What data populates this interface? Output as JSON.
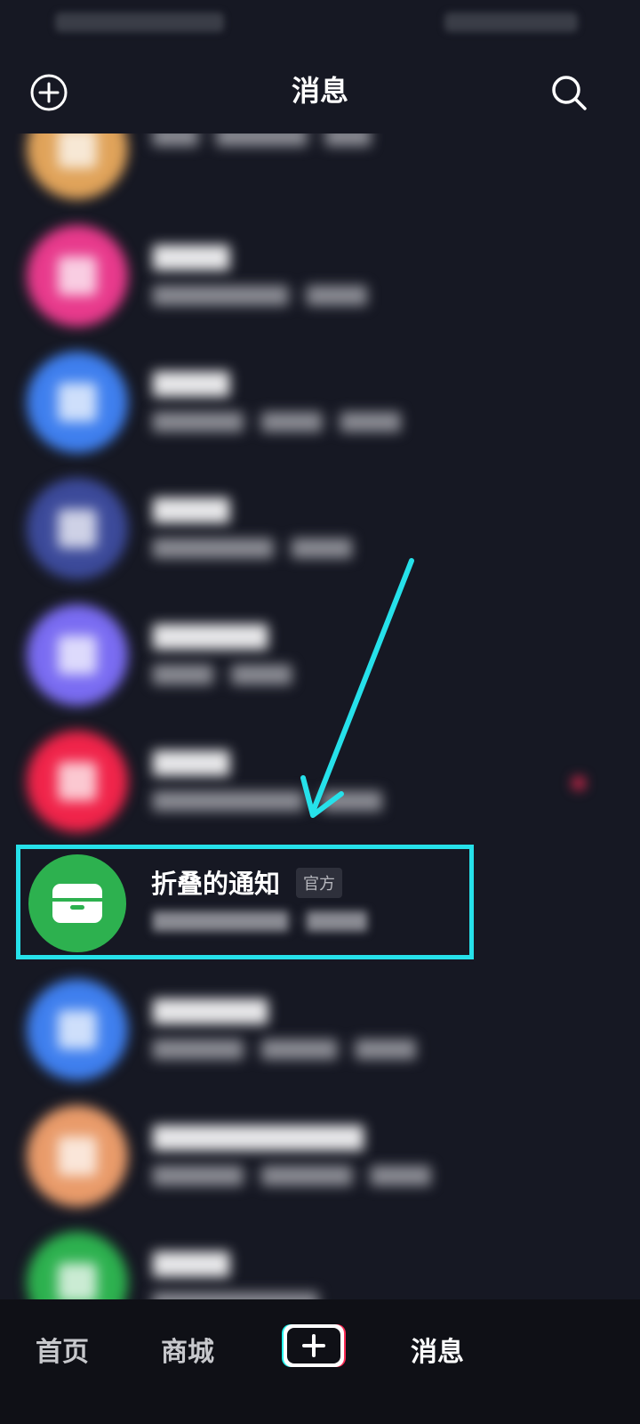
{
  "header": {
    "title": "消息"
  },
  "icons": {
    "add": "add-circle-icon",
    "search": "search-icon",
    "inbox": "inbox-icon",
    "plus": "plus-icon"
  },
  "rows": [
    {
      "avatar_color": "#e0a35a"
    },
    {
      "avatar_color": "#e83a8c"
    },
    {
      "avatar_color": "#3f7fee"
    },
    {
      "avatar_color": "#3c4a9a"
    },
    {
      "avatar_color": "#7a6cf2"
    },
    {
      "avatar_color": "#f0244a"
    },
    {
      "avatar_color": "#3f7fee"
    },
    {
      "avatar_color": "#e99b6a"
    },
    {
      "avatar_color": "#2db14f"
    }
  ],
  "folded_notification": {
    "title": "折叠的通知",
    "badge": "官方",
    "avatar_color": "#2db14f"
  },
  "tabbar": {
    "tabs": [
      "首页",
      "商城",
      "消息"
    ],
    "active": "消息"
  },
  "colors": {
    "background": "#161823",
    "highlight": "#26e1ea",
    "tabbar": "#0f1016",
    "unread_dot": "#fe2c55"
  }
}
